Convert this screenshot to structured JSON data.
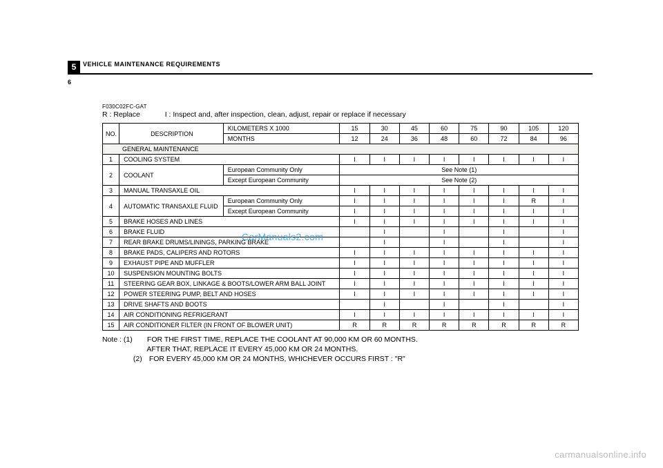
{
  "header": {
    "chapter_num": "5",
    "section_title": "VEHICLE  MAINTENANCE  REQUIREMENTS",
    "page_num": "6"
  },
  "ref_code": "F030C02FC-GAT",
  "legend": {
    "r": "R : Replace",
    "i": "I  : Inspect and, after inspection, clean, adjust, repair or replace if necessary"
  },
  "cols": {
    "no": "NO.",
    "desc": "DESCRIPTION",
    "km": "KILOMETERS X 1000",
    "mo": "MONTHS",
    "km_vals": [
      "15",
      "30",
      "45",
      "60",
      "75",
      "90",
      "105",
      "120"
    ],
    "mo_vals": [
      "12",
      "24",
      "36",
      "48",
      "60",
      "72",
      "84",
      "96"
    ]
  },
  "section_label": "GENERAL  MAINTENANCE",
  "sub_eu": "European  Community  Only",
  "sub_noneu": "Except  European  Community",
  "rows": {
    "r1": {
      "no": "1",
      "desc": "COOLING  SYSTEM",
      "v": [
        "I",
        "I",
        "I",
        "I",
        "I",
        "I",
        "I",
        "I"
      ]
    },
    "r2": {
      "no": "2",
      "desc": "COOLANT",
      "note1": "See  Note  (1)",
      "note2": "See  Note  (2)"
    },
    "r3": {
      "no": "3",
      "desc": "MANUAL  TRANSAXLE  OIL",
      "v": [
        "I",
        "I",
        "I",
        "I",
        "I",
        "I",
        "I",
        "I"
      ]
    },
    "r4": {
      "no": "4",
      "desc": "AUTOMATIC  TRANSAXLE FLUID",
      "v_eu": [
        "I",
        "I",
        "I",
        "I",
        "I",
        "I",
        "R",
        "I",
        "I"
      ],
      "v_ne": [
        "I",
        "I",
        "I",
        "I",
        "I",
        "I",
        "I",
        "I"
      ]
    },
    "r4eu": {
      "v": [
        "I",
        "I",
        "I",
        "I",
        "I",
        "I",
        "R",
        "I"
      ]
    },
    "r4ne": {
      "v": [
        "I",
        "I",
        "I",
        "I",
        "I",
        "I",
        "I",
        "I"
      ]
    },
    "r5": {
      "no": "5",
      "desc": "BRAKE  HOSES  AND  LINES",
      "v": [
        "I",
        "I",
        "I",
        "I",
        "I",
        "I",
        "I",
        "I"
      ]
    },
    "r6": {
      "no": "6",
      "desc": "BRAKE  FLUID",
      "v": [
        "",
        "I",
        "",
        "I",
        "",
        "I",
        "",
        "I"
      ]
    },
    "r7": {
      "no": "7",
      "desc": "REAR  BRAKE  DRUMS/LININGS,  PARKING  BRAKE",
      "v": [
        "",
        "I",
        "",
        "I",
        "",
        "I",
        "",
        "I"
      ]
    },
    "r8": {
      "no": "8",
      "desc": "BRAKE  PADS,  CALIPERS  AND  ROTORS",
      "v": [
        "I",
        "I",
        "I",
        "I",
        "I",
        "I",
        "I",
        "I"
      ]
    },
    "r9": {
      "no": "9",
      "desc": "EXHAUST  PIPE  AND  MUFFLER",
      "v": [
        "I",
        "I",
        "I",
        "I",
        "I",
        "I",
        "I",
        "I"
      ]
    },
    "r10": {
      "no": "10",
      "desc": "SUSPENSION  MOUNTING  BOLTS",
      "v": [
        "I",
        "I",
        "I",
        "I",
        "I",
        "I",
        "I",
        "I"
      ]
    },
    "r11": {
      "no": "11",
      "desc": "STEERING  GEAR  BOX,  LINKAGE  &    BOOTS/LOWER  ARM  BALL  JOINT",
      "v": [
        "I",
        "I",
        "I",
        "I",
        "I",
        "I",
        "I",
        "I"
      ]
    },
    "r12": {
      "no": "12",
      "desc": "POWER  STEERING  PUMP,  BELT  AND  HOSES",
      "v": [
        "I",
        "I",
        "I",
        "I",
        "I",
        "I",
        "I",
        "I"
      ]
    },
    "r13": {
      "no": "13",
      "desc": "DRIVE  SHAFTS  AND  BOOTS",
      "v": [
        "",
        "I",
        "",
        "I",
        "",
        "I",
        "",
        "I"
      ]
    },
    "r14": {
      "no": "14",
      "desc": "AIR  CONDITIONING  REFRIGERANT",
      "v": [
        "I",
        "I",
        "I",
        "I",
        "I",
        "I",
        "I",
        "I"
      ]
    },
    "r15": {
      "no": "15",
      "desc": "AIR  CONDITIONER  FILTER  (IN  FRONT  OF  BLOWER  UNIT)",
      "v": [
        "R",
        "R",
        "R",
        "R",
        "R",
        "R",
        "R",
        "R"
      ]
    }
  },
  "notes": {
    "lead": "Note :  (1)",
    "n1a": "FOR THE FIRST TIME, REPLACE THE COOLANT AT 90,000 KM OR 60 MONTHS.",
    "n1b": "AFTER THAT, REPLACE IT EVERY 45,000 KM OR 24 MONTHS.",
    "n2lead": "(2)",
    "n2": "FOR EVERY 45,000 KM OR 24 MONTHS, WHICHEVER OCCURS FIRST : \"R\""
  },
  "watermarks": {
    "mid": "CarManuals2.com",
    "footer": "carmanualsonline.info"
  }
}
